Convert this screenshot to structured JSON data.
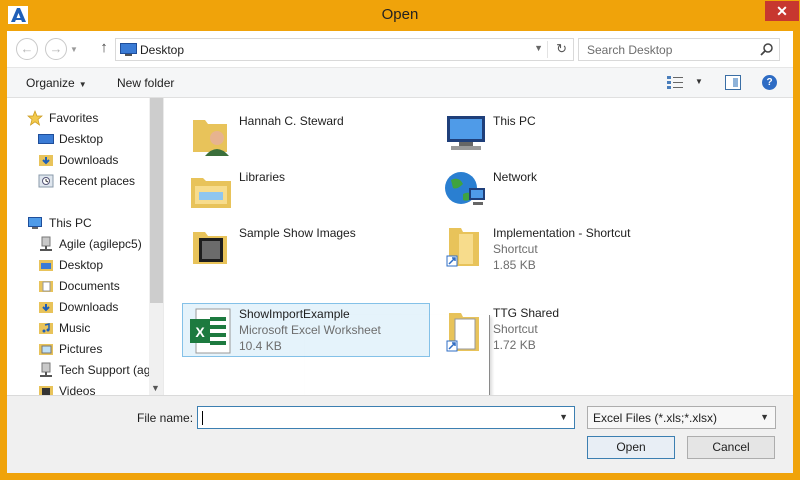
{
  "window": {
    "title": "Open",
    "close_label": "✕",
    "app_icon": "agile-logo-icon"
  },
  "address": {
    "location": "Desktop",
    "refresh": "↻"
  },
  "search": {
    "placeholder": "Search Desktop"
  },
  "toolbar": {
    "organize_label": "Organize",
    "new_folder_label": "New folder",
    "help_label": "?"
  },
  "nav": {
    "items": [
      {
        "label": "Favorites",
        "icon": "star-icon"
      },
      {
        "label": "Desktop",
        "icon": "desktop-icon"
      },
      {
        "label": "Downloads",
        "icon": "downloads-icon"
      },
      {
        "label": "Recent places",
        "icon": "recent-places-icon"
      },
      {
        "label": "This PC",
        "icon": "computer-icon"
      },
      {
        "label": "Agile (agilepc5)",
        "icon": "network-drive-icon"
      },
      {
        "label": "Desktop",
        "icon": "desktop-icon"
      },
      {
        "label": "Documents",
        "icon": "documents-icon"
      },
      {
        "label": "Downloads",
        "icon": "downloads-icon"
      },
      {
        "label": "Music",
        "icon": "music-icon"
      },
      {
        "label": "Pictures",
        "icon": "pictures-icon"
      },
      {
        "label": "Tech Support (ag",
        "icon": "network-drive-icon"
      },
      {
        "label": "Videos",
        "icon": "videos-icon"
      }
    ]
  },
  "files": [
    {
      "name": "Hannah C. Steward",
      "icon": "user-folder-icon"
    },
    {
      "name": "This PC",
      "icon": "computer-icon"
    },
    {
      "name": "Libraries",
      "icon": "libraries-icon"
    },
    {
      "name": "Network",
      "icon": "network-globe-icon"
    },
    {
      "name": "Sample Show Images",
      "icon": "folder-icon"
    },
    {
      "name": "Implementation - Shortcut",
      "type": "Shortcut",
      "size": "1.85 KB",
      "icon": "shortcut-folder-icon"
    },
    {
      "name": "ShowImportExample",
      "type": "Microsoft Excel Worksheet",
      "size": "10.4 KB",
      "icon": "excel-file-icon",
      "selected": true
    },
    {
      "name": "TTG Shared",
      "type": "Shortcut",
      "size": "1.72 KB",
      "icon": "shortcut-folder-icon"
    }
  ],
  "footer": {
    "file_name_label": "File name:",
    "file_name_value": "",
    "file_type": "Excel Files (*.xls;*.xlsx)",
    "open_label": "Open",
    "cancel_label": "Cancel"
  },
  "colors": {
    "frame": "#f0a30a",
    "selection": "#e5f3fb",
    "selection_border": "#84c1e8",
    "close": "#c7372f"
  }
}
